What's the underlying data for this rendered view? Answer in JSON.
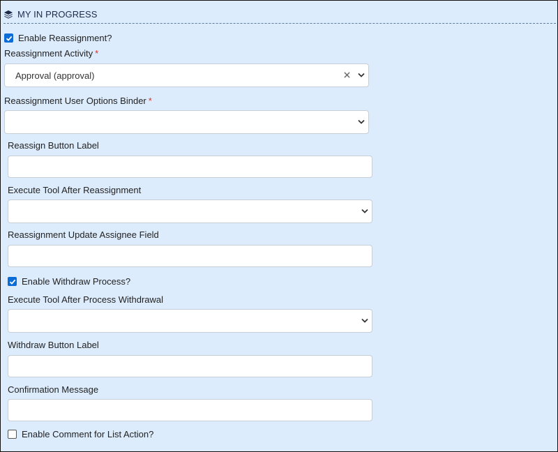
{
  "section": {
    "title": "MY IN PROGRESS"
  },
  "enable_reassignment": {
    "label": "Enable Reassignment?",
    "checked": true
  },
  "reassignment_activity": {
    "label": "Reassignment Activity",
    "required_mark": "*",
    "value": "Approval (approval)"
  },
  "user_options_binder": {
    "label": "Reassignment User Options Binder",
    "required_mark": "*",
    "value": ""
  },
  "reassign_button_label": {
    "label": "Reassign Button Label",
    "value": ""
  },
  "execute_tool_after_reassignment": {
    "label": "Execute Tool After Reassignment",
    "value": ""
  },
  "update_assignee_field": {
    "label": "Reassignment Update Assignee Field",
    "value": ""
  },
  "enable_withdraw": {
    "label": "Enable Withdraw Process?",
    "checked": true
  },
  "execute_tool_after_withdrawal": {
    "label": "Execute Tool After Process Withdrawal",
    "value": ""
  },
  "withdraw_button_label": {
    "label": "Withdraw Button Label",
    "value": ""
  },
  "confirmation_message": {
    "label": "Confirmation Message",
    "value": ""
  },
  "enable_comment": {
    "label": "Enable Comment for List Action?",
    "checked": false
  },
  "colors": {
    "panel_bg": "#dcecfc",
    "accent": "#0b6cd8",
    "required": "#d9302c",
    "header_text": "#1e2a4a"
  }
}
